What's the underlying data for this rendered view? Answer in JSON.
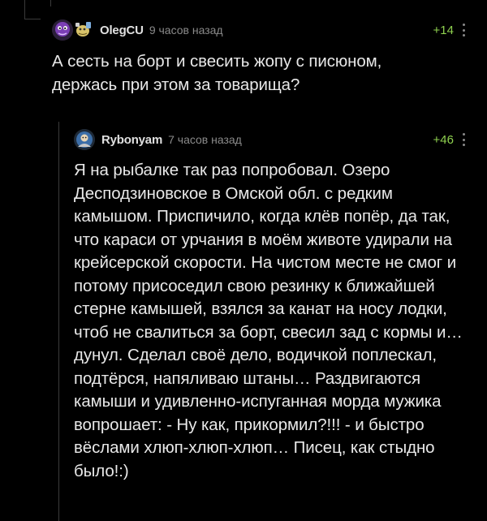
{
  "comments": [
    {
      "author": "OlegCU",
      "time": "9 часов назад",
      "rating": "+14",
      "text": "А сесть на борт и свесить жопу с писюном, держась при этом за товарища?"
    },
    {
      "author": "Rybonyam",
      "time": "7 часов назад",
      "rating": "+46",
      "text": "Я на рыбалке так раз попробовал. Озеро Десподзиновское в Омской обл. с редким камышом. Приспичило, когда клёв попёр, да так, что караси от урчания в моём животе удирали на крейсерской скорости. На чистом месте не смог и потому присоседил свою резинку к ближайшей стерне камышей, взялся за канат на носу лодки, чтоб не свалиться за борт, свесил зад с кормы и… дунул. Сделал своё дело, водичкой поплескал, подтёрся, напяливаю штаны… Раздвигаются камыши и удивленно-испуганная морда мужика вопрошает: - Ну как, прикормил?!!! - и быстро вёслами хлюп-хлюп-хлюп… Писец, как стыдно было!:)"
    }
  ],
  "colors": {
    "background": "#000000",
    "rating_positive": "#8fd14f",
    "text": "#e8e8e8",
    "meta": "#8a8a8a"
  }
}
